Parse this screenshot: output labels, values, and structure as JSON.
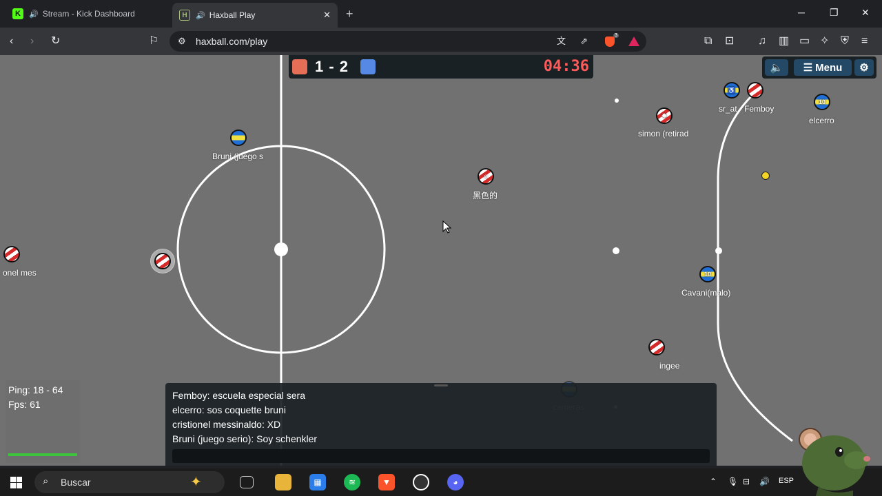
{
  "browser": {
    "tabs": [
      {
        "label": "Stream - Kick Dashboard",
        "active": false
      },
      {
        "label": "Haxball Play",
        "active": true
      }
    ],
    "url": "haxball.com/play",
    "brave_badge": "3"
  },
  "game": {
    "score": "1 - 2",
    "timer": "04:36",
    "menu_label": "Menu",
    "players": [
      {
        "name": "Bruni (juego s",
        "team": "blue"
      },
      {
        "name": "黑色的",
        "team": "red",
        "avatar": "☺"
      },
      {
        "name": "simon (retirad",
        "team": "red",
        "avatar": "✸"
      },
      {
        "name": "sr_at",
        "team": "blue",
        "avatar": "♿"
      },
      {
        "name": "Femboy",
        "team": "red"
      },
      {
        "name": "elcerro",
        "team": "blue",
        "avatar": "10"
      },
      {
        "name": "onel mes",
        "team": "red"
      },
      {
        "name": "",
        "team": "red"
      },
      {
        "name": "Cavani(malo)",
        "team": "blue",
        "avatar": "10"
      },
      {
        "name": "ingee",
        "team": "red"
      },
      {
        "name": "cameras",
        "team": "blue"
      }
    ],
    "stats": {
      "ping": "Ping: 18 - 64",
      "fps": "Fps: 61"
    },
    "chat": [
      "Femboy: escuela especial sera",
      "elcerro: sos coquette bruni",
      "cristionel messinaldo: XD",
      "Bruni (juego serio): Soy schenkler"
    ]
  },
  "taskbar": {
    "search_placeholder": "Buscar",
    "language": "ESP"
  },
  "colors": {
    "field": "#717171",
    "red_team": "#e56e56",
    "blue_team": "#5689e5",
    "timer": "#ff5a5a"
  }
}
